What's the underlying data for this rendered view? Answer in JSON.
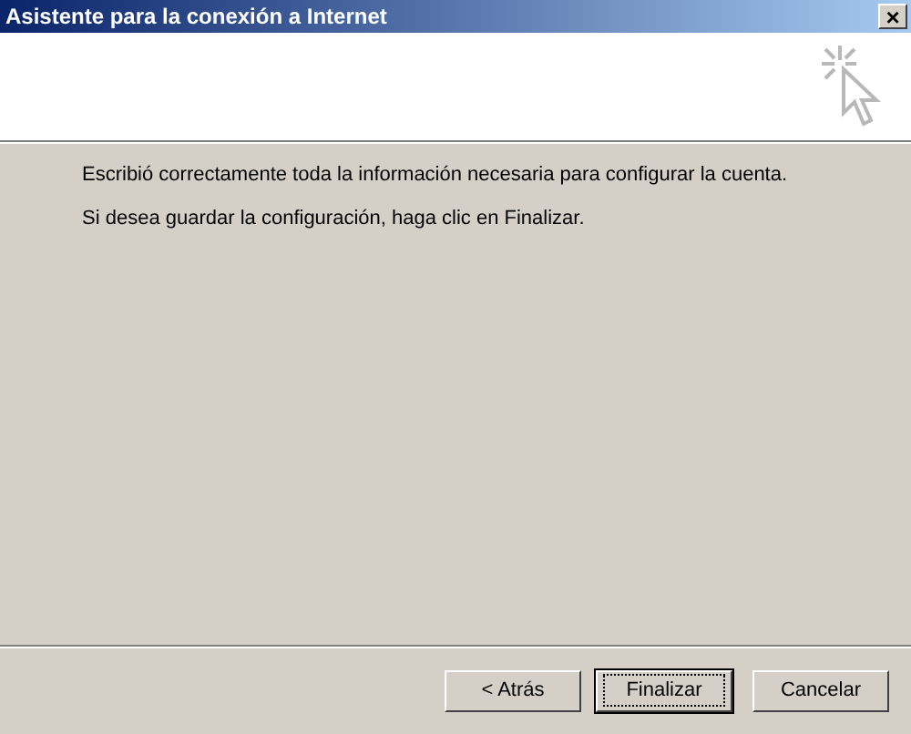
{
  "window": {
    "title": "Asistente para la conexión a Internet",
    "close_button": "×"
  },
  "body": {
    "paragraphs": [
      "Escribió correctamente toda la información necesaria para configurar la cuenta.",
      "Si desea guardar la configuración, haga clic en Finalizar."
    ]
  },
  "buttons": [
    {
      "label": "< Atrás",
      "default": false
    },
    {
      "label": "Finalizar",
      "default": true
    },
    {
      "label": "Cancelar",
      "default": false
    }
  ]
}
